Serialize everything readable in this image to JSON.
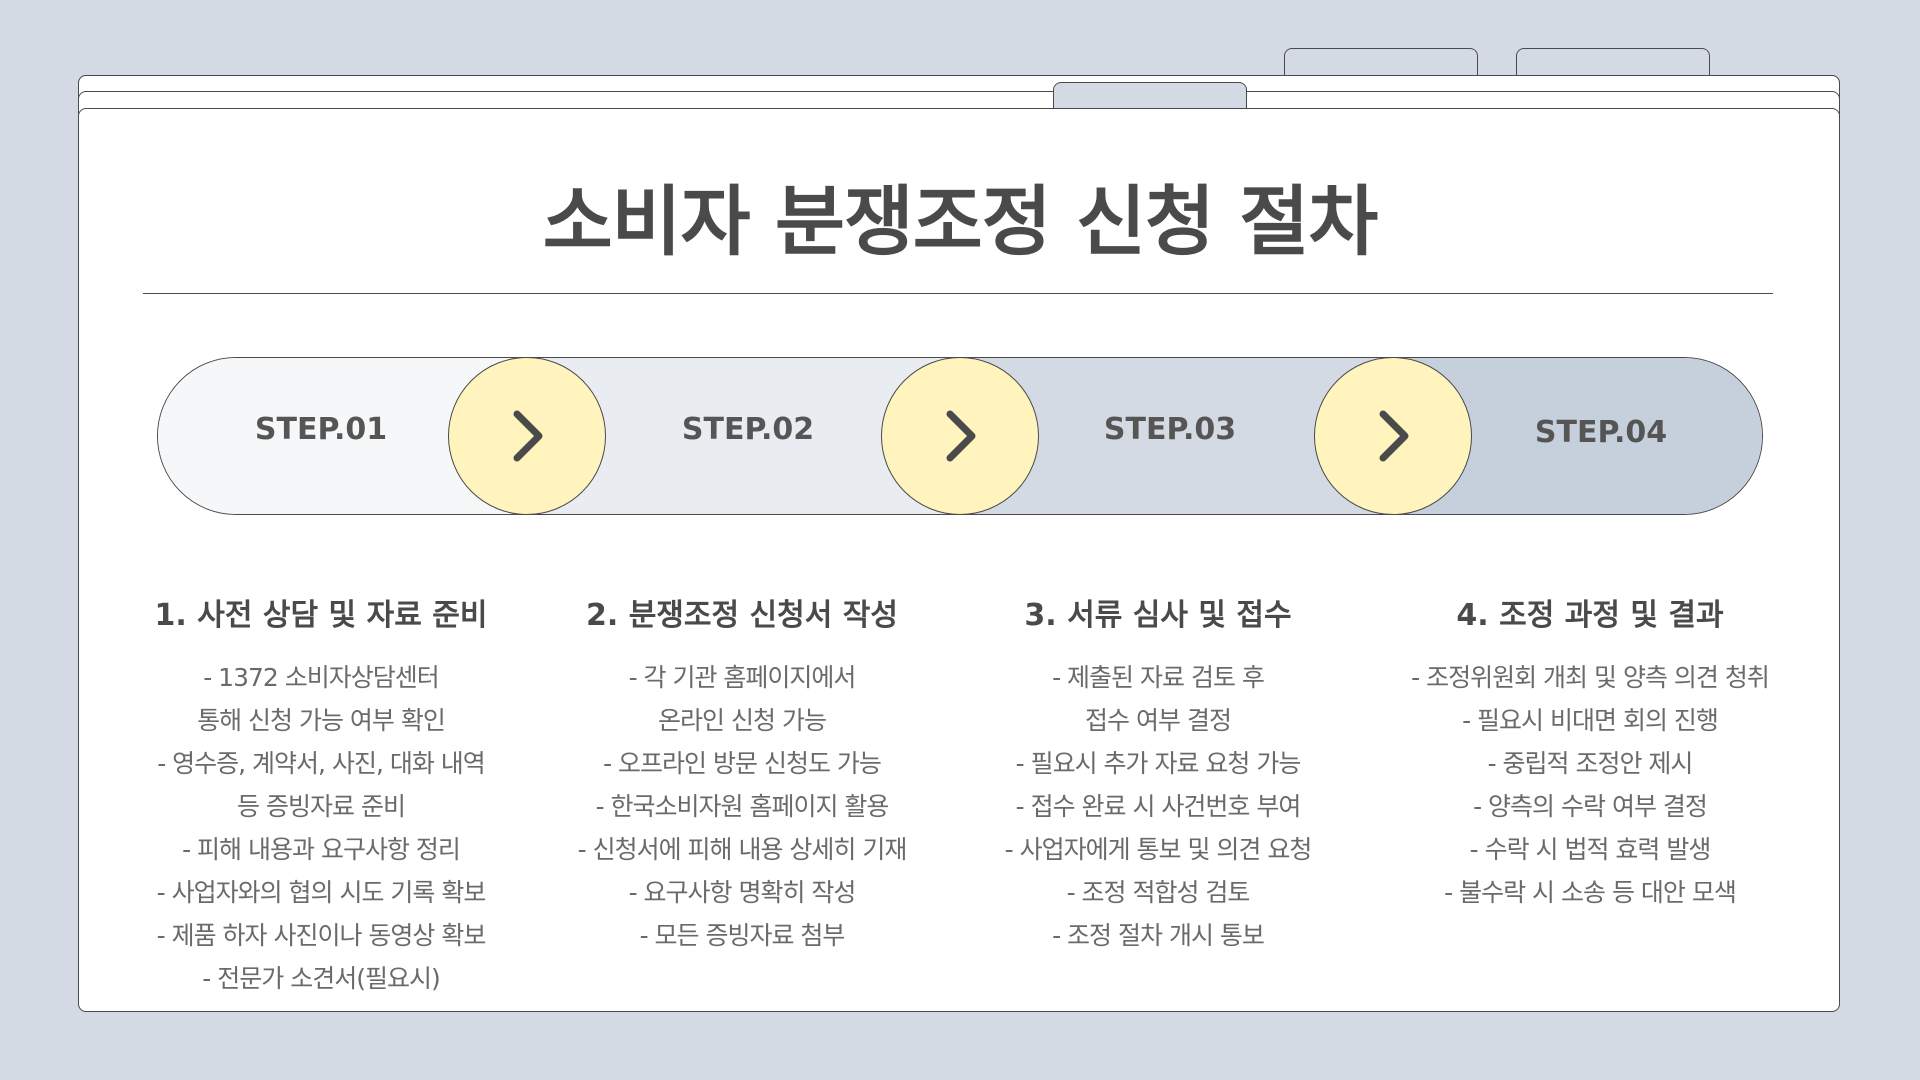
{
  "title": "소비자 분쟁조정 신청 절차",
  "colors": {
    "background": "#d4dae4",
    "arrow_fill": "#fff4bd",
    "step1_fill": "#f6f7f8",
    "step2_fill": "#e9ecf0",
    "step3_fill": "#d4dae4",
    "step4_fill": "#c6cfdc"
  },
  "arrow_icon": "chevron-right-icon",
  "steps": [
    {
      "label": "STEP.01",
      "heading": "1. 사전 상담 및 자료 준비",
      "lines": [
        "- 1372 소비자상담센터",
        "통해 신청 가능 여부 확인",
        "- 영수증, 계약서, 사진, 대화 내역",
        "등 증빙자료 준비",
        "- 피해 내용과 요구사항 정리",
        "- 사업자와의 협의 시도 기록 확보",
        "- 제품 하자 사진이나 동영상 확보",
        "- 전문가 소견서(필요시)"
      ]
    },
    {
      "label": "STEP.02",
      "heading": "2. 분쟁조정 신청서 작성",
      "lines": [
        "- 각 기관 홈페이지에서",
        "온라인 신청 가능",
        "- 오프라인 방문 신청도 가능",
        "- 한국소비자원 홈페이지 활용",
        "- 신청서에 피해 내용 상세히 기재",
        "- 요구사항 명확히 작성",
        "- 모든 증빙자료 첨부"
      ]
    },
    {
      "label": "STEP.03",
      "heading": "3. 서류 심사 및 접수",
      "lines": [
        "- 제출된 자료 검토 후",
        "접수 여부 결정",
        "- 필요시 추가 자료 요청 가능",
        "- 접수 완료 시 사건번호 부여",
        "- 사업자에게 통보 및 의견 요청",
        "- 조정 적합성 검토",
        "- 조정 절차 개시 통보"
      ]
    },
    {
      "label": "STEP.04",
      "heading": "4. 조정 과정 및 결과",
      "lines": [
        "- 조정위원회 개최 및 양측 의견 청취",
        "- 필요시 비대면 회의 진행",
        "- 중립적 조정안 제시",
        "- 양측의 수락 여부 결정",
        "- 수락 시 법적 효력 발생",
        "- 불수락 시 소송 등 대안 모색"
      ]
    }
  ]
}
